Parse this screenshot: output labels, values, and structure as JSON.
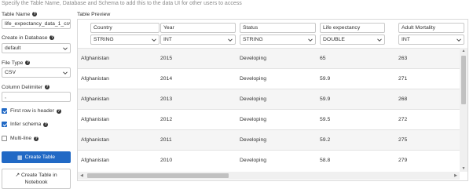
{
  "instructions": "Specify the Table Name, Database and Schema to add this to the data UI for other users to access",
  "form": {
    "table_name_label": "Table Name",
    "table_name_value": "life_expectancy_data_1_csv",
    "create_in_db_label": "Create in Database",
    "create_in_db_value": "default",
    "file_type_label": "File Type",
    "file_type_value": "CSV",
    "column_delimiter_label": "Column Delimiter",
    "column_delimiter_value": ",",
    "first_row_header_label": "First row is header",
    "first_row_header_checked": true,
    "infer_schema_label": "Infer schema",
    "infer_schema_checked": true,
    "multi_line_label": "Multi-line",
    "multi_line_checked": false,
    "create_table_label": "Create Table",
    "create_table_notebook_label_line1": "Create Table in",
    "create_table_notebook_label_line2": "Notebook"
  },
  "preview": {
    "title": "Table Preview",
    "columns": [
      {
        "name": "Country",
        "type": "STRING"
      },
      {
        "name": "Year",
        "type": "INT"
      },
      {
        "name": "Status",
        "type": "STRING"
      },
      {
        "name": "Life expectancy",
        "type": "DOUBLE"
      },
      {
        "name": "Adult Mortality",
        "type": "INT"
      }
    ],
    "rows": [
      [
        "Afghanistan",
        "2015",
        "Developing",
        "65",
        "263"
      ],
      [
        "Afghanistan",
        "2014",
        "Developing",
        "59.9",
        "271"
      ],
      [
        "Afghanistan",
        "2013",
        "Developing",
        "59.9",
        "268"
      ],
      [
        "Afghanistan",
        "2012",
        "Developing",
        "59.5",
        "272"
      ],
      [
        "Afghanistan",
        "2011",
        "Developing",
        "59.2",
        "275"
      ],
      [
        "Afghanistan",
        "2010",
        "Developing",
        "58.8",
        "279"
      ]
    ]
  },
  "colors": {
    "primary": "#2169c5",
    "row_alt": "#f5f5f5",
    "border": "#c8c8c8"
  }
}
